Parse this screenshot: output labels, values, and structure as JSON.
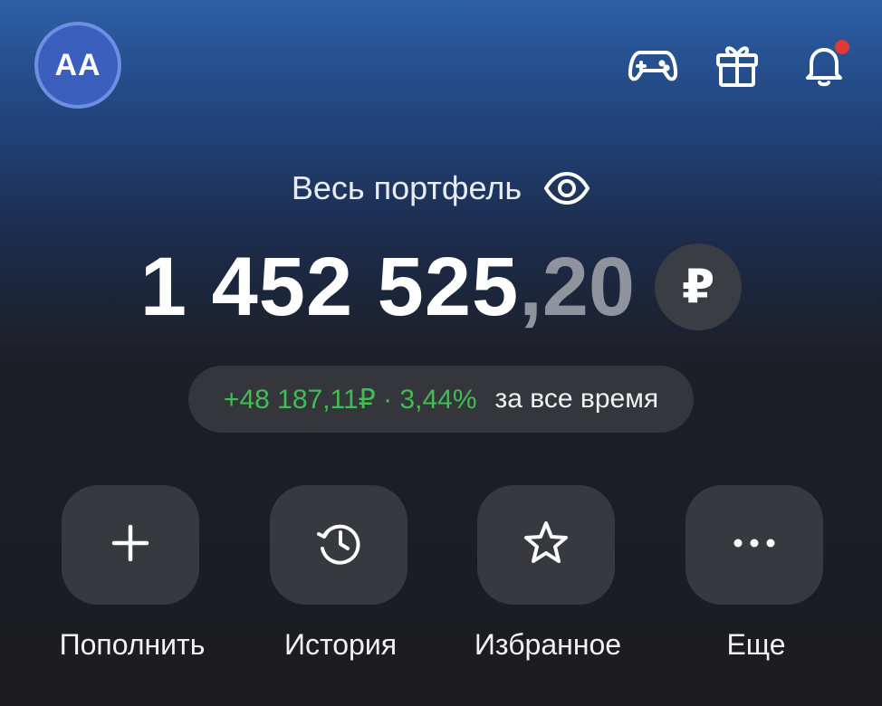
{
  "header": {
    "avatar_initials": "AA",
    "icons": [
      "game-controller-icon",
      "gift-icon",
      "bell-icon"
    ],
    "notification_dot_color": "#e23a33"
  },
  "portfolio": {
    "label": "Весь портфель",
    "balance_integer": "1 452 525",
    "balance_fraction": ",20",
    "currency": "₽"
  },
  "gain": {
    "value": "+48 187,11₽ · 3,44%",
    "period": "за все время",
    "color": "#3fbf52"
  },
  "actions": [
    {
      "label": "Пополнить",
      "icon": "plus-icon"
    },
    {
      "label": "История",
      "icon": "history-icon"
    },
    {
      "label": "Избранное",
      "icon": "star-icon"
    },
    {
      "label": "Еще",
      "icon": "more-icon"
    }
  ]
}
